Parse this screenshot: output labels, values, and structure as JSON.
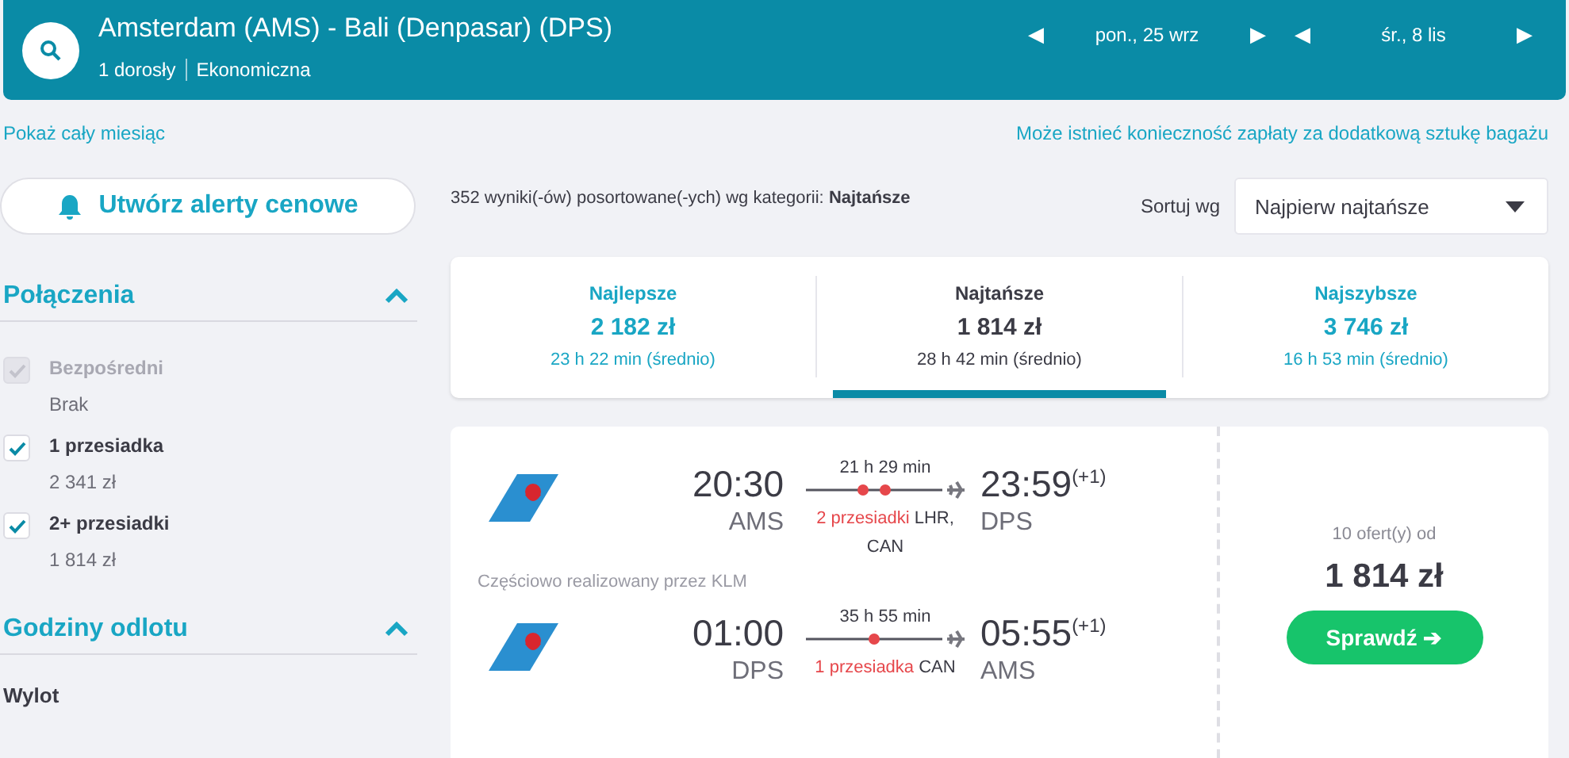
{
  "header": {
    "route": "Amsterdam (AMS) - Bali (Denpasar) (DPS)",
    "passengers": "1 dorosły",
    "cabin": "Ekonomiczna",
    "dates": [
      {
        "prev": "◀",
        "label": "pon., 25 wrz",
        "next": "▶"
      },
      {
        "prev": "◀",
        "label": "śr., 8 lis",
        "next": "▶"
      }
    ]
  },
  "links": {
    "month": "Pokaż cały miesiąc",
    "baggage": "Może istnieć konieczność zapłaty za dodatkową sztukę bagażu"
  },
  "sidebar": {
    "alert_button": "Utwórz alerty cenowe",
    "sections": [
      {
        "title": "Połączenia",
        "expanded": true,
        "options": [
          {
            "label": "Bezpośredni",
            "price": "Brak",
            "checked": true,
            "disabled": true
          },
          {
            "label": "1 przesiadka",
            "price": "2 341 zł",
            "checked": true,
            "disabled": false
          },
          {
            "label": "2+ przesiadki",
            "price": "1 814 zł",
            "checked": true,
            "disabled": false
          }
        ]
      },
      {
        "title": "Godziny odlotu",
        "expanded": true,
        "subtitle": "Wylot"
      }
    ]
  },
  "summary": "352 wyniki(-ów) posortowane(-ych) wg kategorii: **Najtańsze**",
  "sort": {
    "label": "Sortuj wg",
    "value": "Najpierw najtańsze"
  },
  "tabs": [
    {
      "label": "Najlepsze",
      "price": "2 182 zł",
      "duration": "23 h 22 min (średnio)",
      "selected": false
    },
    {
      "label": "Najtańsze",
      "price": "1 814 zł",
      "duration": "28 h 42 min (średnio)",
      "selected": true
    },
    {
      "label": "Najszybsze",
      "price": "3 746 zł",
      "duration": "16 h 53 min (średnio)",
      "selected": false
    }
  ],
  "result": {
    "legs": [
      {
        "dep_time": "20:30",
        "dep_airport": "AMS",
        "duration": "21 h 29 min",
        "stops_label": "2 przesiadki",
        "stops": [
          "LHR,",
          "CAN"
        ],
        "arr_time": "23:59$^{(+1)}$",
        "arr_airport": "DPS"
      },
      {
        "operated_by": "Częściowo realizowany przez KLM",
        "dep_time": "01:00",
        "dep_airport": "DPS",
        "duration": "35 h 55 min",
        "stops_label": "1 przesiadka",
        "stops": [
          "CAN"
        ],
        "arr_time": "05:55$^{(+1)}$",
        "arr_airport": "AMS"
      }
    ],
    "offers": "10 ofert(y) od",
    "price": "1 814 zł",
    "button": "Sprawdź ➔"
  }
}
